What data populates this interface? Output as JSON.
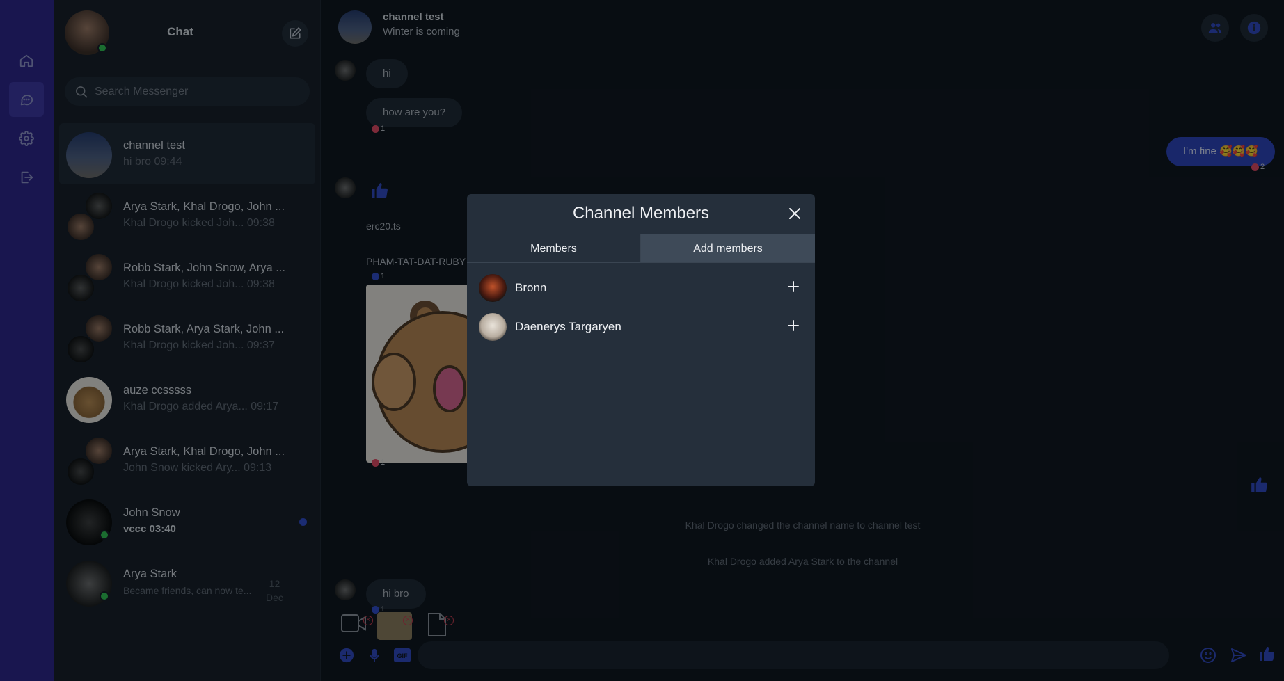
{
  "sidebar": {
    "title": "Chat",
    "search_placeholder": "Search Messenger",
    "conversations": [
      {
        "name": "channel test",
        "preview": "hi bro  09:44"
      },
      {
        "name": "Arya Stark, Khal Drogo, John ...",
        "preview": "Khal Drogo kicked Joh...   09:38"
      },
      {
        "name": "Robb Stark, John Snow, Arya ...",
        "preview": "Khal Drogo kicked Joh...   09:38"
      },
      {
        "name": "Robb Stark, Arya Stark, John ...",
        "preview": "Khal Drogo kicked Joh...   09:37"
      },
      {
        "name": "auze ccsssss",
        "preview": "Khal Drogo added Arya...   09:17"
      },
      {
        "name": "Arya Stark, Khal Drogo, John ...",
        "preview": "John Snow kicked Ary...   09:13"
      },
      {
        "name": "John Snow",
        "preview": "vccc  03:40"
      },
      {
        "name": "Arya Stark",
        "preview": "Became friends, can now te...",
        "date": "12",
        "month": "Dec"
      }
    ]
  },
  "header": {
    "title": "channel test",
    "subtitle": "Winter is coming"
  },
  "messages": {
    "m1": "hi",
    "m2": "how are you?",
    "m2_react": "1",
    "m3": "I'm fine 🥰🥰🥰",
    "m3_react": "2",
    "file1": "erc20.ts",
    "file2": "PHAM-TAT-DAT-RUBY",
    "file2_react": "1",
    "img_react": "1",
    "sys1": "Khal Drogo changed the channel name to channel test",
    "sys2": "Khal Drogo added Arya Stark to the channel",
    "m4": "hi bro",
    "m4_react": "1"
  },
  "modal": {
    "title": "Channel Members",
    "tabs": [
      "Members",
      "Add members"
    ],
    "active_tab": "Add members",
    "candidates": [
      {
        "name": "Bronn"
      },
      {
        "name": "Daenerys Targaryen"
      }
    ]
  },
  "colors": {
    "rail": "#2b2288",
    "accent": "#2e46c0",
    "online": "#2ec04f"
  }
}
